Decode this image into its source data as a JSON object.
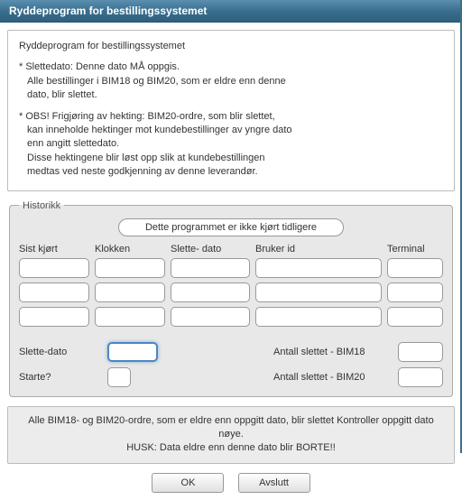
{
  "title": "Ryddeprogram for bestillingssystemet",
  "info": {
    "heading": "Ryddeprogram for bestillingssystemet",
    "p1_l1": "* Slettedato: Denne dato MÅ oppgis.",
    "p1_l2": "Alle bestillinger i BIM18 og BIM20, som er eldre enn denne",
    "p1_l3": "dato, blir slettet.",
    "p2_l1": "* OBS! Frigjøring av hekting: BIM20-ordre, som blir slettet,",
    "p2_l2": "kan inneholde hektinger mot kundebestillinger av yngre dato",
    "p2_l3": "enn angitt slettedato.",
    "p2_l4": "Disse hektingene blir løst opp slik at kundebestillingen",
    "p2_l5": "medtas ved neste godkjenning av denne leverandør."
  },
  "hist": {
    "legend": "Historikk",
    "status": "Dette programmet er ikke kjørt tidligere",
    "cols": {
      "sist": "Sist kjørt",
      "klok": "Klokken",
      "sdato": "Slette- dato",
      "bruker": "Bruker id",
      "term": "Terminal"
    }
  },
  "form": {
    "slettedato_label": "Slette-dato",
    "slettedato_value": "",
    "starte_label": "Starte?",
    "antall18_label": "Antall slettet - BIM18",
    "antall20_label": "Antall slettet - BIM20"
  },
  "warn": {
    "l1": "Alle BIM18- og BIM20-ordre, som er eldre enn oppgitt dato, blir slettet Kontroller oppgitt dato nøye.",
    "l2": "HUSK: Data eldre enn denne dato blir BORTE!!"
  },
  "buttons": {
    "ok": "OK",
    "avslutt": "Avslutt"
  }
}
